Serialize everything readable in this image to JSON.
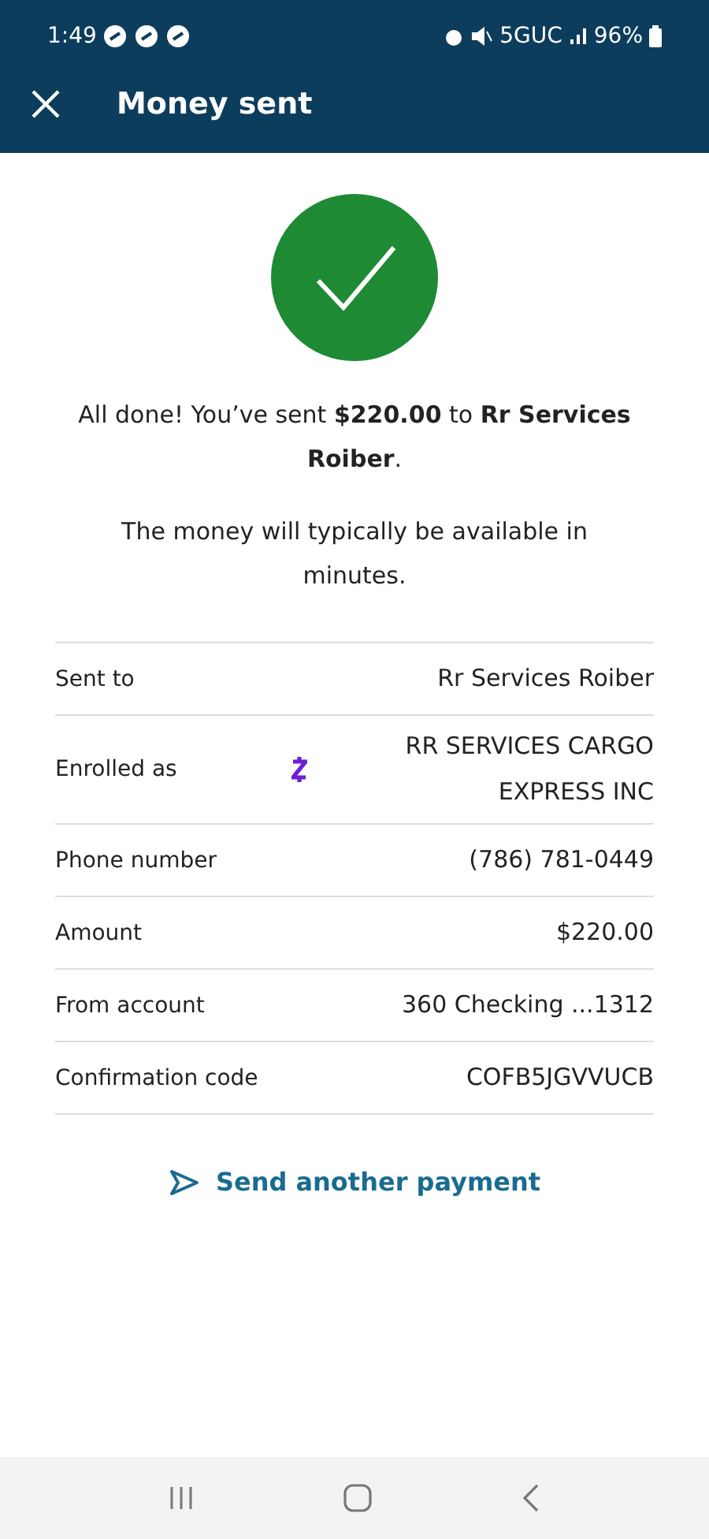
{
  "status_bar": {
    "time": "1:49",
    "network": "5GUC",
    "battery": "96%"
  },
  "header": {
    "title": "Money sent"
  },
  "message": "All done! You’ve sent **$220.00** to **Rr Services Roiber**.",
  "note": "The money will typically be available in minutes.",
  "details": [
    {
      "kind": "plain",
      "label": "Sent to",
      "value": "Rr Services Roiber"
    },
    {
      "kind": "zelle",
      "label": "Enrolled as",
      "value": "RR SERVICES CARGO EXPRESS INC"
    },
    {
      "kind": "plain",
      "label": "Phone number",
      "value": "(786) 781-0449"
    },
    {
      "kind": "plain",
      "label": "Amount",
      "value": "$220.00"
    },
    {
      "kind": "plain",
      "label": "From account",
      "value": "360 Checking ...1312"
    },
    {
      "kind": "plain",
      "label": "Confirmation code",
      "value": "COFB5JGVVUCB"
    }
  ],
  "action": {
    "label": "Send another payment"
  }
}
